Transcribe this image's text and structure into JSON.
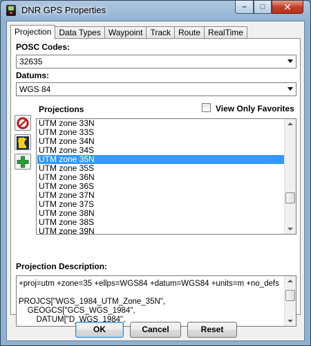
{
  "window": {
    "title": "DNR GPS Properties"
  },
  "tabs": [
    {
      "label": "Projection",
      "active": true
    },
    {
      "label": "Data Types"
    },
    {
      "label": "Waypoint"
    },
    {
      "label": "Track"
    },
    {
      "label": "Route"
    },
    {
      "label": "RealTime"
    }
  ],
  "posc": {
    "label": "POSC Codes:",
    "value": "32635"
  },
  "datums": {
    "label": "Datums:",
    "value": "WGS 84"
  },
  "projections": {
    "label": "Projections",
    "view_only_favorites": {
      "label": "View Only Favorites",
      "checked": false
    },
    "items": [
      "UTM zone 33N",
      "UTM zone 33S",
      "UTM zone 34N",
      "UTM zone 34S",
      "UTM zone 35N",
      "UTM zone 35S",
      "UTM zone 36N",
      "UTM zone 36S",
      "UTM zone 37N",
      "UTM zone 37S",
      "UTM zone 38N",
      "UTM zone 38S",
      "UTM zone 39N"
    ],
    "selected_index": 4
  },
  "description": {
    "label": "Projection Description:",
    "lines": [
      "+proj=utm +zone=35 +ellps=WGS84 +datum=WGS84 +units=m +no_defs  <>",
      "",
      "PROJCS[\"WGS_1984_UTM_Zone_35N\",",
      "    GEOGCS[\"GCS_WGS_1984\",",
      "        DATUM[\"D_WGS_1984\","
    ]
  },
  "buttons": {
    "ok": "OK",
    "cancel": "Cancel",
    "reset": "Reset"
  },
  "colors": {
    "selection": "#3399ff",
    "titlebar": "#8fb2d3",
    "close": "#c4412a"
  }
}
